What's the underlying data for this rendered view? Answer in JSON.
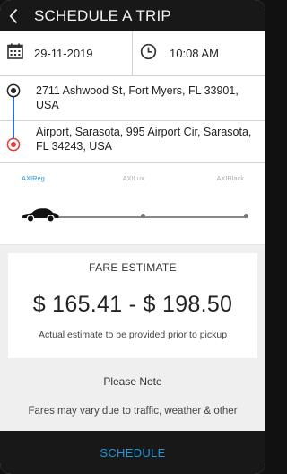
{
  "header": {
    "title": "SCHEDULE A TRIP",
    "back_icon": "chevron-left-icon"
  },
  "schedule": {
    "date": "29-11-2019",
    "time": "10:08 AM",
    "date_icon": "calendar-icon",
    "time_icon": "clock-icon"
  },
  "route": {
    "pickup": "2711 Ashwood St, Fort Myers, FL 33901, USA",
    "dropoff": "Airport, Sarasota, 995 Airport Cir, Sarasota, FL 34243, USA",
    "rail_color": "#2b6fd6",
    "drop_color": "#e53935"
  },
  "vehicles": {
    "options": [
      "AXIReg",
      "AXILux",
      "AXIBlack"
    ],
    "selected": "AXIReg",
    "active_color": "#2196d8"
  },
  "fare": {
    "title": "FARE ESTIMATE",
    "amount": "$ 165.41 - $ 198.50",
    "note": "Actual estimate to be provided prior to pickup"
  },
  "notice": {
    "title": "Please Note",
    "text": "Fares may vary due to traffic, weather & other"
  },
  "footer": {
    "button_label": "SCHEDULE"
  }
}
